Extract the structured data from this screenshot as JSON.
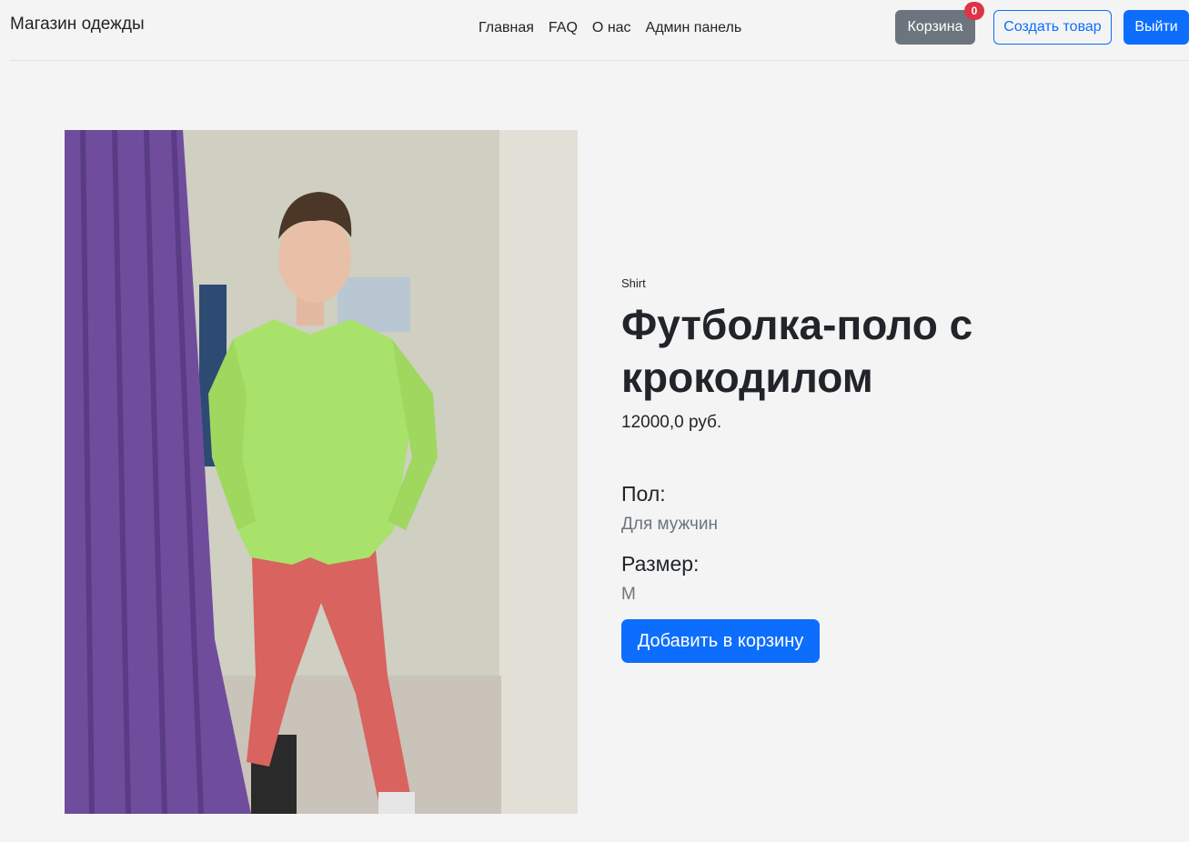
{
  "navbar": {
    "brand": "Магазин одежды",
    "links": [
      "Главная",
      "FAQ",
      "О нас",
      "Админ панель"
    ],
    "cart_label": "Корзина",
    "cart_count": "0",
    "create_label": "Создать товар",
    "logout_label": "Выйти"
  },
  "product": {
    "category": "Shirt",
    "title": "Футболка-поло с крокодилом",
    "price": "12000,0 руб.",
    "gender_label": "Пол:",
    "gender_value": "Для мужчин",
    "size_label": "Размер:",
    "size_value": "M",
    "add_to_cart_label": "Добавить в корзину"
  },
  "colors": {
    "primary": "#0d6efd",
    "secondary": "#6c757d",
    "danger": "#dc3545",
    "background": "#f4f4f4"
  }
}
